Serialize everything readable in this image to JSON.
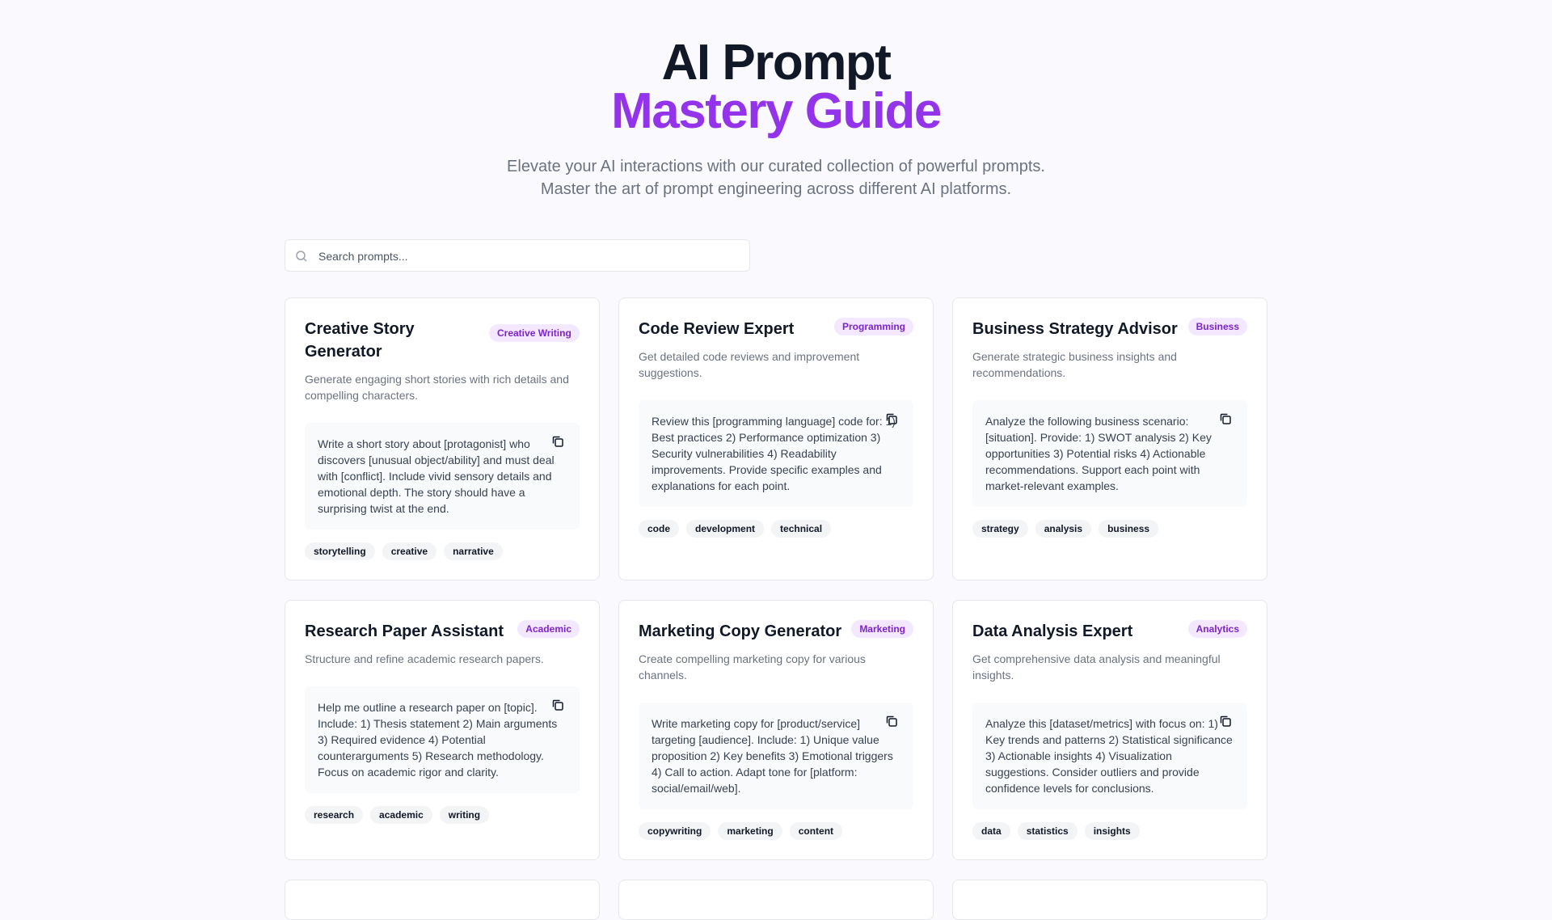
{
  "hero": {
    "title_line1": "AI Prompt",
    "title_line2": "Mastery Guide",
    "subtitle_line1": "Elevate your AI interactions with our curated collection of powerful prompts.",
    "subtitle_line2": "Master the art of prompt engineering across different AI platforms."
  },
  "search": {
    "placeholder": "Search prompts..."
  },
  "colors": {
    "accent": "#9333ea",
    "badge_bg": "#f3e8ff",
    "badge_text": "#7e22ce",
    "tag_bg": "#f3f4f6"
  },
  "cards": [
    {
      "title": "Creative Story Generator",
      "category": "Creative Writing",
      "description": "Generate engaging short stories with rich details and compelling characters.",
      "prompt": "Write a short story about [protagonist] who discovers [unusual object/ability] and must deal with [conflict]. Include vivid sensory details and emotional depth. The story should have a surprising twist at the end.",
      "tags": [
        "storytelling",
        "creative",
        "narrative"
      ]
    },
    {
      "title": "Code Review Expert",
      "category": "Programming",
      "description": "Get detailed code reviews and improvement suggestions.",
      "prompt": "Review this [programming language] code for: 1) Best practices 2) Performance optimization 3) Security vulnerabilities 4) Readability improvements. Provide specific examples and explanations for each point.",
      "tags": [
        "code",
        "development",
        "technical"
      ]
    },
    {
      "title": "Business Strategy Advisor",
      "category": "Business",
      "description": "Generate strategic business insights and recommendations.",
      "prompt": "Analyze the following business scenario: [situation]. Provide: 1) SWOT analysis 2) Key opportunities 3) Potential risks 4) Actionable recommendations. Support each point with market-relevant examples.",
      "tags": [
        "strategy",
        "analysis",
        "business"
      ]
    },
    {
      "title": "Research Paper Assistant",
      "category": "Academic",
      "description": "Structure and refine academic research papers.",
      "prompt": "Help me outline a research paper on [topic]. Include: 1) Thesis statement 2) Main arguments 3) Required evidence 4) Potential counterarguments 5) Research methodology. Focus on academic rigor and clarity.",
      "tags": [
        "research",
        "academic",
        "writing"
      ]
    },
    {
      "title": "Marketing Copy Generator",
      "category": "Marketing",
      "description": "Create compelling marketing copy for various channels.",
      "prompt": "Write marketing copy for [product/service] targeting [audience]. Include: 1) Unique value proposition 2) Key benefits 3) Emotional triggers 4) Call to action. Adapt tone for [platform: social/email/web].",
      "tags": [
        "copywriting",
        "marketing",
        "content"
      ]
    },
    {
      "title": "Data Analysis Expert",
      "category": "Analytics",
      "description": "Get comprehensive data analysis and meaningful insights.",
      "prompt": "Analyze this [dataset/metrics] with focus on: 1) Key trends and patterns 2) Statistical significance 3) Actionable insights 4) Visualization suggestions. Consider outliers and provide confidence levels for conclusions.",
      "tags": [
        "data",
        "statistics",
        "insights"
      ]
    }
  ]
}
